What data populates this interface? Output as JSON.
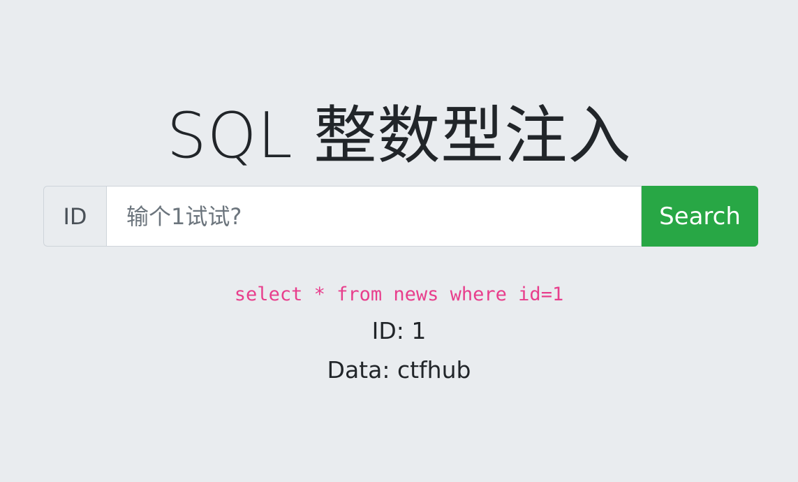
{
  "page": {
    "title": "SQL 整数型注入"
  },
  "search": {
    "prepend_label": "ID",
    "placeholder": "输个1试试?",
    "value": "",
    "button_label": "Search"
  },
  "result": {
    "query": "select * from news where id=1",
    "id_line": "ID: 1",
    "data_line": "Data: ctfhub"
  },
  "colors": {
    "background": "#e9ecef",
    "button": "#28a745",
    "query_text": "#e83e8c"
  }
}
